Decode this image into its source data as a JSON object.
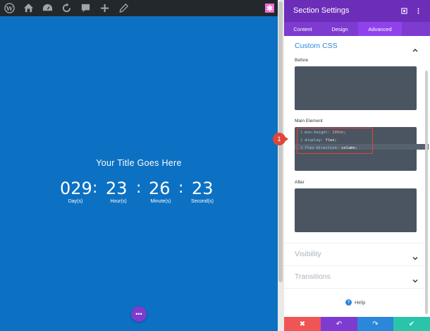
{
  "toolbar": {
    "icons": [
      "wordpress-icon",
      "sitemap-icon",
      "dashboard-icon",
      "refresh-icon",
      "comment-icon",
      "plus-icon",
      "edit-icon"
    ],
    "accent": "#f06bd5"
  },
  "canvas": {
    "background": "#0c71c3",
    "title": "Your Title Goes Here",
    "countdown": {
      "days": "029",
      "hours": "23",
      "minutes": "26",
      "seconds": "23",
      "separator": ":",
      "days_label": "Day(s)",
      "hours_label": "Hour(s)",
      "minutes_label": "Minute(s)",
      "seconds_label": "Second(s)"
    },
    "fab_label": "•••",
    "pink_button_label": "✱"
  },
  "panel": {
    "title": "Section Settings",
    "header_color": "#6c2eb9",
    "tabs": [
      {
        "label": "Content"
      },
      {
        "label": "Design"
      },
      {
        "label": "Advanced"
      }
    ],
    "active_tab": "Advanced",
    "custom_css": {
      "heading": "Custom CSS",
      "before_label": "Before",
      "main_label": "Main Element",
      "after_label": "After",
      "main_code": [
        {
          "num": "1",
          "prop": "min-height:",
          "value": "100vh",
          "end": ";"
        },
        {
          "num": "2",
          "prop": "display:",
          "value": "flex",
          "end": ";"
        },
        {
          "num": "3",
          "prop": "flex-direction:",
          "value": "column",
          "end": ";"
        }
      ]
    },
    "visibility_heading": "Visibility",
    "transitions_heading": "Transitions",
    "help_label": "Help",
    "badge": "1",
    "footer": {
      "cancel": "✖",
      "undo": "↶",
      "redo": "↷",
      "save": "✔",
      "colors": {
        "cancel": "#ef5555",
        "undo": "#7e3bd0",
        "redo": "#2b87da",
        "save": "#29c4a9"
      }
    }
  }
}
